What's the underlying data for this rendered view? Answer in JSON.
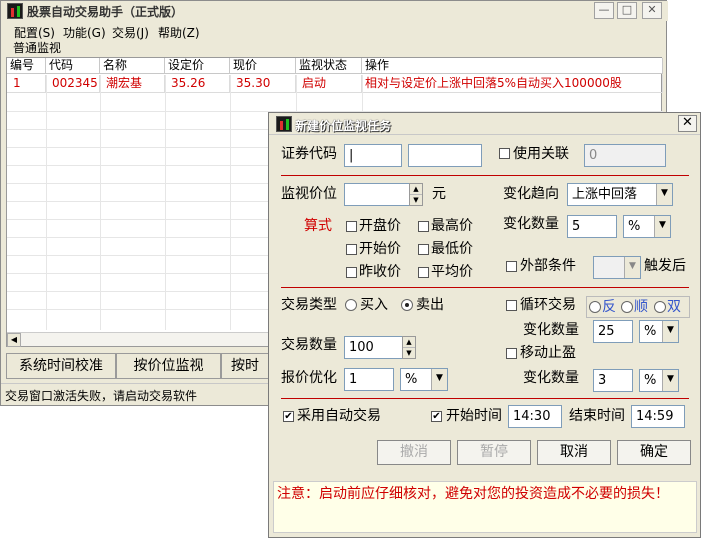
{
  "main_window": {
    "title": "股票自动交易助手（正式版）",
    "min_label": "—",
    "max_label": "□",
    "close_label": "✕",
    "menu": [
      "配置(S)",
      "功能(G)",
      "交易(J)",
      "帮助(Z)"
    ],
    "section_label": "普通监视",
    "table": {
      "headers": [
        "编号",
        "代码",
        "名称",
        "设定价",
        "现价",
        "监视状态",
        "操作"
      ],
      "rows": [
        [
          "1",
          "002345",
          "潮宏基",
          "35.26",
          "35.30",
          "启动",
          "相对与设定价上涨中回落5%自动买入100000股"
        ]
      ]
    },
    "tabs": [
      "系统时间校准",
      "按价位监视",
      "按时"
    ],
    "status": "交易窗口激活失败，请启动交易软件"
  },
  "dialog": {
    "title": "新建价位监视任务",
    "close_label": "✕",
    "code_label": "证券代码",
    "code_value": "|",
    "use_link_label": "使用关联",
    "use_link_value": "0",
    "monitor_price_label": "监视价位",
    "yuan_label": "元",
    "formula_label": "算式",
    "price_options": [
      "开盘价",
      "最高价",
      "开始价",
      "最低价",
      "昨收价",
      "平均价"
    ],
    "trend_label": "变化趋向",
    "trend_value": "上涨中回落",
    "change_qty_label": "变化数量",
    "change_qty_value": "5",
    "change_unit": "%",
    "external_cond_label": "外部条件",
    "trigger_label": "触发后",
    "trade_type_label": "交易类型",
    "buy_label": "买入",
    "sell_label": "卖出",
    "cycle_trade_label": "循环交易",
    "cycle_options": [
      "反",
      "顺",
      "双"
    ],
    "cycle_change_label": "变化数量",
    "cycle_change_value": "25",
    "cycle_change_unit": "%",
    "trade_qty_label": "交易数量",
    "trade_qty_value": "100",
    "move_stop_label": "移动止盈",
    "quote_opt_label": "报价优化",
    "quote_opt_value": "1",
    "quote_opt_unit": "%",
    "stop_change_label": "变化数量",
    "stop_change_value": "3",
    "stop_change_unit": "%",
    "auto_trade_label": "采用自动交易",
    "start_time_label": "开始时间",
    "start_time_value": "14:30",
    "end_time_label": "结束时间",
    "end_time_value": "14:59",
    "buttons": {
      "revoke": "撤消",
      "pause": "暂停",
      "cancel": "取消",
      "ok": "确定"
    },
    "note": "注意：启动前应仔细核对，避免对您的投资造成不必要的损失！"
  },
  "colors": {
    "accent_red": "#d00000",
    "window_bg": "#ece9d8"
  }
}
